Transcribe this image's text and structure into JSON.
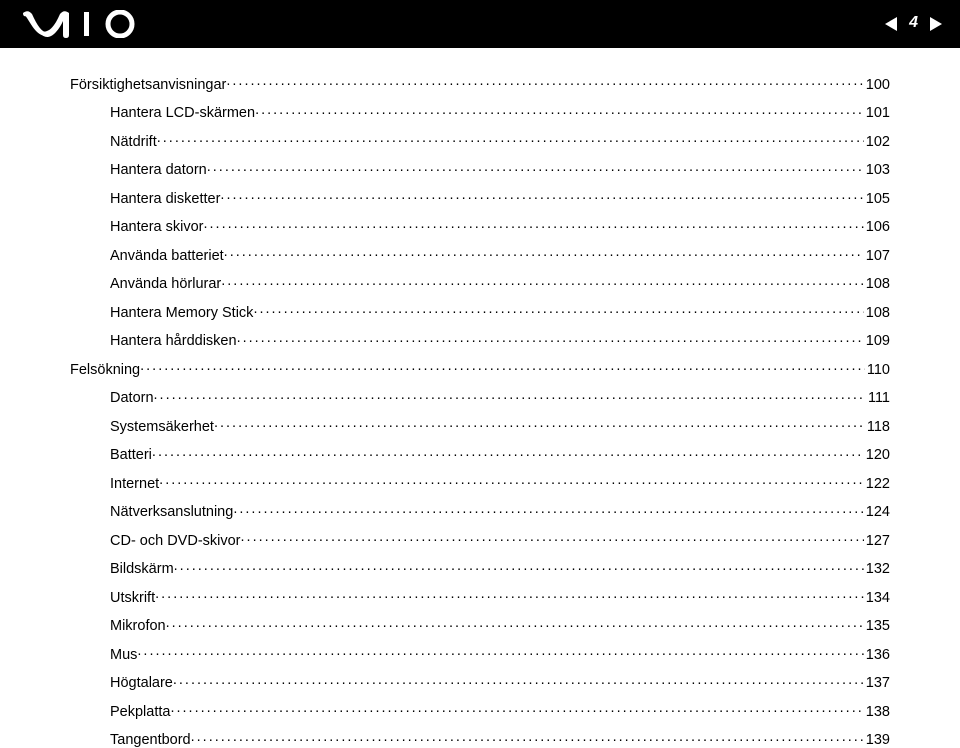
{
  "header": {
    "logo_text": "VAIO",
    "page_number": "4"
  },
  "toc": [
    {
      "level": 1,
      "title": "Försiktighetsanvisningar",
      "page": "100"
    },
    {
      "level": 2,
      "title": "Hantera LCD-skärmen",
      "page": "101"
    },
    {
      "level": 2,
      "title": "Nätdrift",
      "page": "102"
    },
    {
      "level": 2,
      "title": "Hantera datorn",
      "page": "103"
    },
    {
      "level": 2,
      "title": "Hantera disketter",
      "page": "105"
    },
    {
      "level": 2,
      "title": "Hantera skivor",
      "page": "106"
    },
    {
      "level": 2,
      "title": "Använda batteriet",
      "page": "107"
    },
    {
      "level": 2,
      "title": "Använda hörlurar",
      "page": "108"
    },
    {
      "level": 2,
      "title": "Hantera Memory Stick",
      "page": "108"
    },
    {
      "level": 2,
      "title": "Hantera hårddisken",
      "page": "109"
    },
    {
      "level": 1,
      "title": "Felsökning",
      "page": "110"
    },
    {
      "level": 2,
      "title": "Datorn",
      "page": "111"
    },
    {
      "level": 2,
      "title": "Systemsäkerhet",
      "page": "118"
    },
    {
      "level": 2,
      "title": "Batteri",
      "page": "120"
    },
    {
      "level": 2,
      "title": "Internet",
      "page": "122"
    },
    {
      "level": 2,
      "title": "Nätverksanslutning",
      "page": "124"
    },
    {
      "level": 2,
      "title": "CD- och DVD-skivor",
      "page": "127"
    },
    {
      "level": 2,
      "title": "Bildskärm",
      "page": "132"
    },
    {
      "level": 2,
      "title": "Utskrift",
      "page": "134"
    },
    {
      "level": 2,
      "title": "Mikrofon",
      "page": "135"
    },
    {
      "level": 2,
      "title": "Mus",
      "page": "136"
    },
    {
      "level": 2,
      "title": "Högtalare",
      "page": "137"
    },
    {
      "level": 2,
      "title": "Pekplatta",
      "page": "138"
    },
    {
      "level": 2,
      "title": "Tangentbord",
      "page": "139"
    }
  ]
}
